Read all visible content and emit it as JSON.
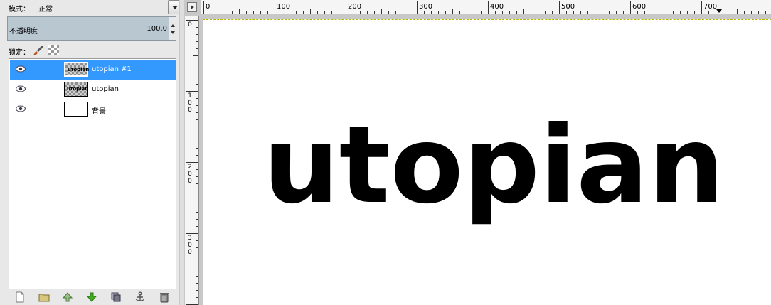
{
  "mode": {
    "label": "模式：",
    "value": "正常"
  },
  "opacity": {
    "label": "不透明度",
    "value": "100.0"
  },
  "lock": {
    "label": "锁定："
  },
  "layers": [
    {
      "name": "utopian #1",
      "thumb_text": "utopian",
      "selected": true
    },
    {
      "name": "utopian",
      "thumb_text": "utopian",
      "selected": false
    },
    {
      "name": "背景",
      "thumb_text": "",
      "selected": false
    }
  ],
  "bottom_buttons": [
    "new-layer-icon",
    "layer-group-icon",
    "raise-layer-icon",
    "lower-layer-icon",
    "duplicate-layer-icon",
    "anchor-layer-icon",
    "delete-layer-icon"
  ],
  "ruler": {
    "horizontal": [
      "0",
      "100",
      "200",
      "300",
      "400",
      "500",
      "600",
      "700"
    ],
    "vertical": [
      "0",
      "100",
      "200",
      "300"
    ]
  },
  "canvas": {
    "text": "utopian"
  },
  "colors": {
    "selection": "#3399ff",
    "accent_green": "#44aa22",
    "opacity_bar": "#b9c7d1"
  }
}
